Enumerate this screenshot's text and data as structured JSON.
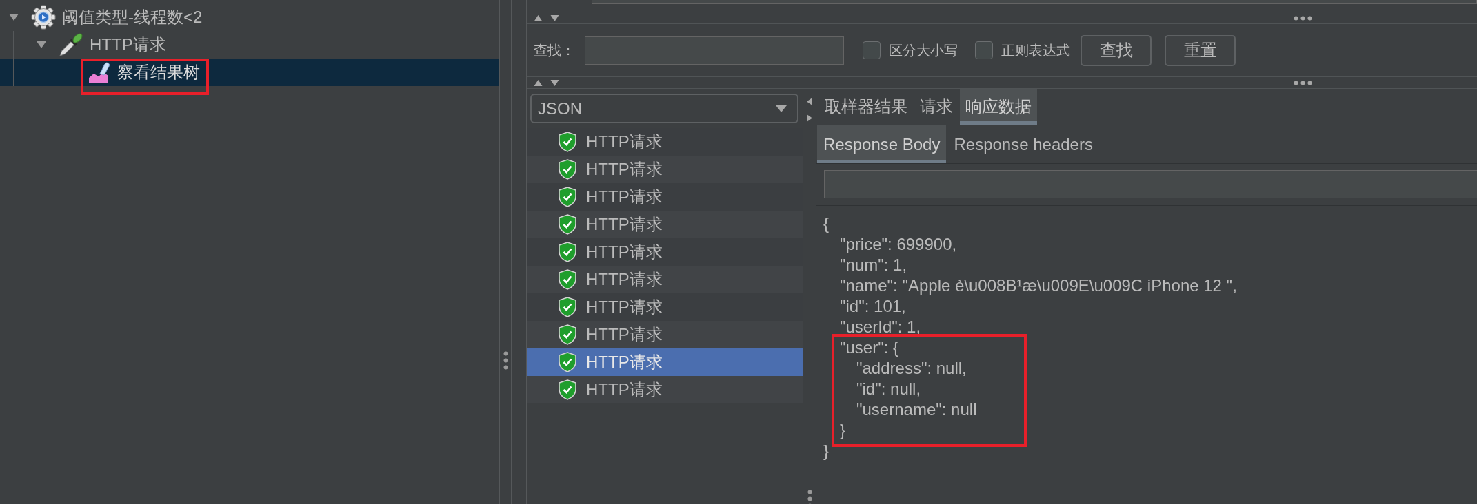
{
  "tree": {
    "items": [
      {
        "kind": "group",
        "label": "阈值类型-线程数<2",
        "expanded": true,
        "selected": false,
        "highlighted": false,
        "children": [
          {
            "kind": "sampler",
            "label": "HTTP请求",
            "expanded": true,
            "selected": false,
            "highlighted": false,
            "children": [
              {
                "kind": "listener",
                "label": "察看结果树",
                "selected": true,
                "highlighted": true
              }
            ]
          }
        ]
      }
    ]
  },
  "search": {
    "label": "查找：",
    "options": [
      {
        "label": "区分大小写",
        "checked": false
      },
      {
        "label": "正则表达式",
        "checked": false
      }
    ],
    "buttons": [
      "查找",
      "重置"
    ]
  },
  "results": {
    "format": "JSON",
    "items": [
      {
        "label": "HTTP请求",
        "success": true,
        "selected": false
      },
      {
        "label": "HTTP请求",
        "success": true,
        "selected": false
      },
      {
        "label": "HTTP请求",
        "success": true,
        "selected": false
      },
      {
        "label": "HTTP请求",
        "success": true,
        "selected": false
      },
      {
        "label": "HTTP请求",
        "success": true,
        "selected": false
      },
      {
        "label": "HTTP请求",
        "success": true,
        "selected": false
      },
      {
        "label": "HTTP请求",
        "success": true,
        "selected": false
      },
      {
        "label": "HTTP请求",
        "success": true,
        "selected": false
      },
      {
        "label": "HTTP请求",
        "success": true,
        "selected": true
      },
      {
        "label": "HTTP请求",
        "success": true,
        "selected": false
      }
    ]
  },
  "detail": {
    "tabs": [
      {
        "label": "取样器结果",
        "selected": false
      },
      {
        "label": "请求",
        "selected": false
      },
      {
        "label": "响应数据",
        "selected": true
      }
    ],
    "body_tabs": [
      {
        "label": "Response Body",
        "selected": true
      },
      {
        "label": "Response headers",
        "selected": false
      }
    ],
    "response_body": [
      {
        "text": "{",
        "highlighted": false,
        "closing": "}",
        "children": [
          {
            "text": "\"price\": 699900,",
            "highlighted": false
          },
          {
            "text": "\"num\": 1,",
            "highlighted": false
          },
          {
            "text": "\"name\": \"Apple è\\u008B¹æ\\u009E\\u009C iPhone 12 \",",
            "highlighted": false
          },
          {
            "text": "\"id\": 101,",
            "highlighted": false
          },
          {
            "text": "\"userId\": 1,",
            "highlighted": false
          },
          {
            "text": "\"user\": {",
            "highlighted": true,
            "closing": "}",
            "children": [
              {
                "text": "\"address\": null,",
                "highlighted": false
              },
              {
                "text": "\"id\": null,",
                "highlighted": false
              },
              {
                "text": "\"username\": null",
                "highlighted": false
              }
            ]
          }
        ]
      }
    ]
  }
}
